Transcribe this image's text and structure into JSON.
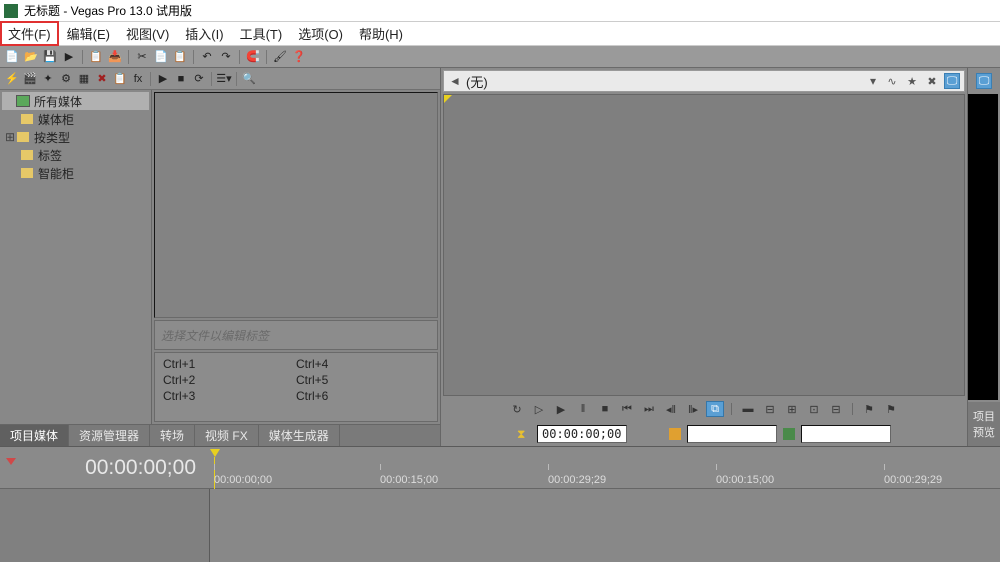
{
  "titlebar": {
    "title": "无标题 - Vegas Pro 13.0 试用版"
  },
  "menu": {
    "file": "文件(F)",
    "edit": "编辑(E)",
    "view": "视图(V)",
    "insert": "插入(I)",
    "tools": "工具(T)",
    "options": "选项(O)",
    "help": "帮助(H)"
  },
  "tree": {
    "all_media": "所有媒体",
    "media_bin": "媒体柜",
    "by_type": "按类型",
    "tags": "标签",
    "smart_bin": "智能柜"
  },
  "tags_hint": "选择文件以编辑标签",
  "shortcuts": {
    "c1": "Ctrl+1",
    "c2": "Ctrl+2",
    "c3": "Ctrl+3",
    "c4": "Ctrl+4",
    "c5": "Ctrl+5",
    "c6": "Ctrl+6"
  },
  "tabs": {
    "project_media": "项目媒体",
    "explorer": "资源管理器",
    "transitions": "转场",
    "video_fx": "视频 FX",
    "media_gen": "媒体生成器"
  },
  "preview": {
    "dropdown_value": "(无)"
  },
  "status": {
    "timecode": "00:00:00;00"
  },
  "monitor": {
    "tab1": "项目",
    "tab2": "预览"
  },
  "timeline": {
    "cursor_time": "00:00:00;00",
    "ticks": [
      "00:00:00;00",
      "00:00:15;00",
      "00:00:29;29",
      "00:00:15;00",
      "00:00:29;29"
    ]
  }
}
